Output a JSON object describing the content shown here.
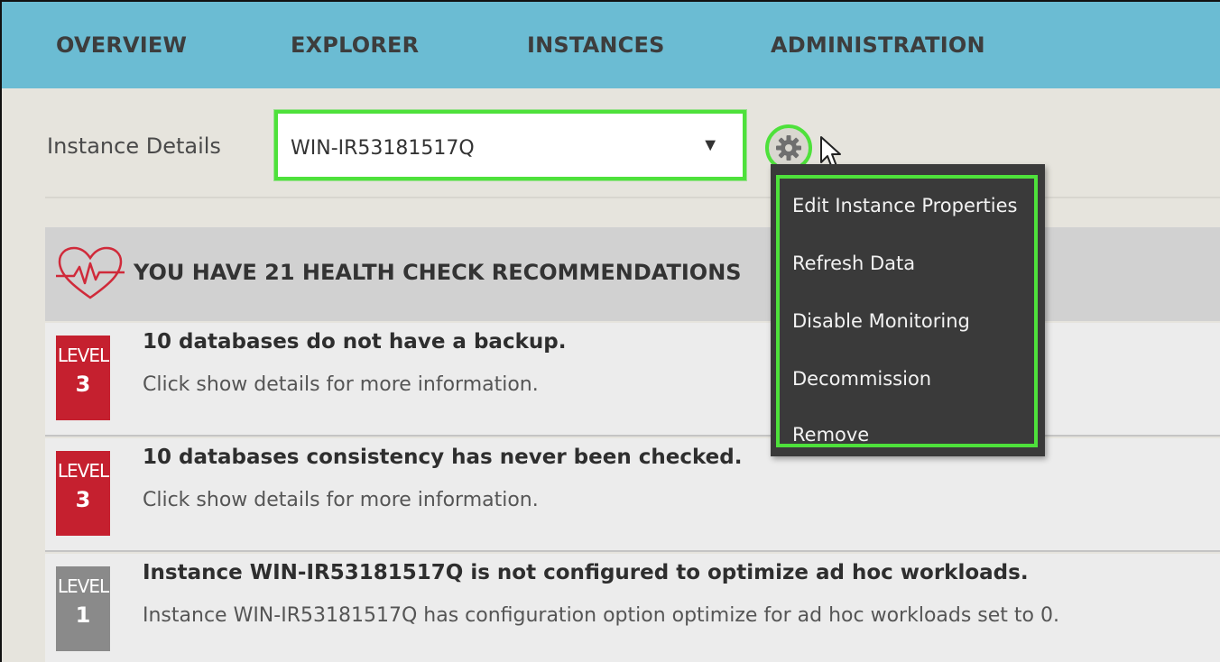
{
  "nav": {
    "items": [
      {
        "label": "OVERVIEW"
      },
      {
        "label": "EXPLORER"
      },
      {
        "label": "INSTANCES"
      },
      {
        "label": "ADMINISTRATION"
      }
    ]
  },
  "details": {
    "label": "Instance Details",
    "selected_instance": "WIN-IR53181517Q",
    "arrow": "▼"
  },
  "menu": {
    "items": [
      {
        "label": "Edit Instance Properties"
      },
      {
        "label": "Refresh Data"
      },
      {
        "label": "Disable Monitoring"
      },
      {
        "label": "Decommission"
      },
      {
        "label": "Remove"
      }
    ]
  },
  "health": {
    "title": "YOU HAVE 21 HEALTH CHECK RECOMMENDATIONS",
    "icon": "heartbeat-icon",
    "recommendations": [
      {
        "level_word": "LEVEL",
        "level": "3",
        "title": "10 databases do not have a backup.",
        "description": "Click show details for more information."
      },
      {
        "level_word": "LEVEL",
        "level": "3",
        "title": "10 databases consistency has never been checked.",
        "description": "Click show details for more information."
      },
      {
        "level_word": "LEVEL",
        "level": "1",
        "title": "Instance WIN-IR53181517Q is not configured to optimize ad hoc workloads.",
        "description": "Instance WIN-IR53181517Q has configuration option optimize for ad hoc workloads set to 0."
      }
    ]
  },
  "colors": {
    "nav_bg": "#6bbcd3",
    "highlight": "#4ee13b",
    "level3": "#c5202f",
    "level1": "#8a8a8a",
    "menu_bg": "#3a3a3a"
  }
}
